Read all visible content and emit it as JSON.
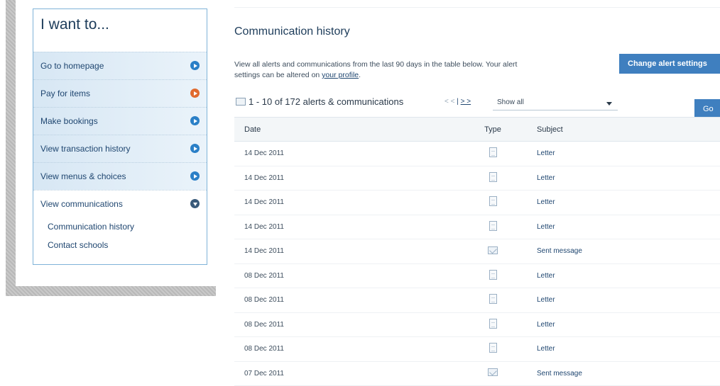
{
  "sidebar": {
    "title": "I want to...",
    "items": [
      {
        "label": "Go to homepage",
        "icon": "arrow-right-icon"
      },
      {
        "label": "Pay for items",
        "icon": "arrow-right-icon"
      },
      {
        "label": "Make bookings",
        "icon": "arrow-right-icon"
      },
      {
        "label": "View transaction history",
        "icon": "arrow-right-icon"
      },
      {
        "label": "View menus & choices",
        "icon": "arrow-right-icon"
      },
      {
        "label": "View communications",
        "icon": "arrow-down-icon"
      }
    ],
    "subitems": [
      "Communication history",
      "Contact schools"
    ],
    "colors": {
      "accent_blue": "#2a7fc7",
      "accent_orange": "#e06a2f",
      "border": "#7fb3d8"
    }
  },
  "main": {
    "title": "Communication history",
    "intro_text": "View all alerts and communications from the last 90 days in the table below. Your alert settings can be altered on ",
    "intro_link": "your profile",
    "intro_end": ".",
    "change_button": "Change alert settings",
    "pager": {
      "summary": "1 - 10 of 172 alerts & communications",
      "prev": "< <",
      "sep": "|",
      "next": "> >"
    },
    "filter": {
      "selected": "Show all"
    },
    "go_button": "Go",
    "table": {
      "headers": {
        "date": "Date",
        "type": "Type",
        "subject": "Subject"
      },
      "rows": [
        {
          "date": "14 Dec 2011",
          "type": "letter",
          "subject": "Letter"
        },
        {
          "date": "14 Dec 2011",
          "type": "letter",
          "subject": "Letter"
        },
        {
          "date": "14 Dec 2011",
          "type": "letter",
          "subject": "Letter"
        },
        {
          "date": "14 Dec 2011",
          "type": "letter",
          "subject": "Letter"
        },
        {
          "date": "14 Dec 2011",
          "type": "message",
          "subject": "Sent message"
        },
        {
          "date": "08 Dec 2011",
          "type": "letter",
          "subject": "Letter"
        },
        {
          "date": "08 Dec 2011",
          "type": "letter",
          "subject": "Letter"
        },
        {
          "date": "08 Dec 2011",
          "type": "letter",
          "subject": "Letter"
        },
        {
          "date": "08 Dec 2011",
          "type": "letter",
          "subject": "Letter"
        },
        {
          "date": "07 Dec 2011",
          "type": "message",
          "subject": "Sent message"
        }
      ]
    },
    "colors": {
      "button": "#3f7fbf",
      "link": "#1f4670"
    }
  }
}
